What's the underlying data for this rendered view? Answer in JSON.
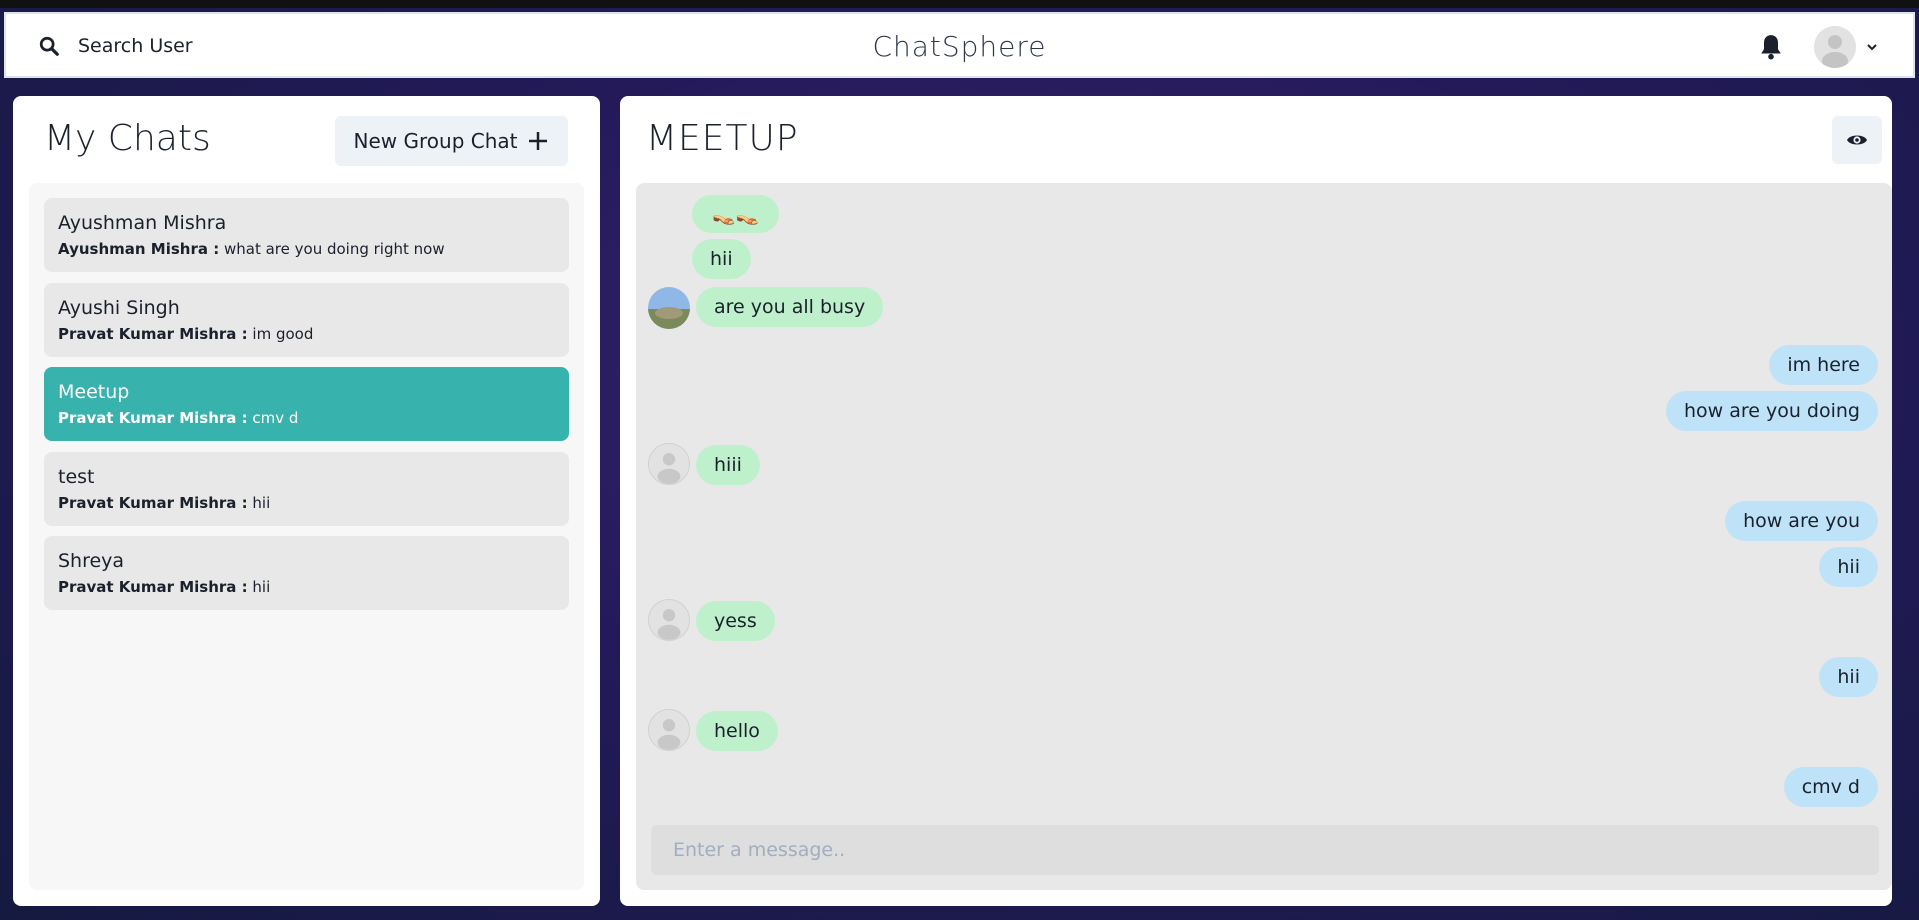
{
  "header": {
    "search_label": "Search User",
    "app_title": "ChatSphere",
    "icons": {
      "search": "search-icon",
      "notifications": "bell-icon",
      "profile": "avatar",
      "menu": "chevron-down-icon"
    }
  },
  "sidebar": {
    "title": "My Chats",
    "new_group_label": "New Group Chat",
    "chats": [
      {
        "name": "Ayushman Mishra",
        "sender": "Ayushman Mishra :",
        "message": "what are you doing right now",
        "active": false
      },
      {
        "name": "Ayushi Singh",
        "sender": "Pravat Kumar Mishra :",
        "message": "im good",
        "active": false
      },
      {
        "name": "Meetup",
        "sender": "Pravat Kumar Mishra :",
        "message": "cmv d",
        "active": true
      },
      {
        "name": "test",
        "sender": "Pravat Kumar Mishra :",
        "message": "hii",
        "active": false
      },
      {
        "name": "Shreya",
        "sender": "Pravat Kumar Mishra :",
        "message": "hii",
        "active": false
      }
    ]
  },
  "chat": {
    "title": "MEETUP",
    "messages": [
      {
        "from": "them",
        "text": "👡👡"
      },
      {
        "from": "them",
        "text": "hii"
      },
      {
        "from": "them",
        "text": "are you all busy"
      },
      {
        "from": "me",
        "text": "im here"
      },
      {
        "from": "me",
        "text": "how are you doing"
      },
      {
        "from": "them",
        "text": "hiii"
      },
      {
        "from": "me",
        "text": "how are you"
      },
      {
        "from": "me",
        "text": "hii"
      },
      {
        "from": "them",
        "text": "yess"
      },
      {
        "from": "me",
        "text": "hii"
      },
      {
        "from": "them",
        "text": "hello"
      },
      {
        "from": "me",
        "text": "cmv d"
      }
    ],
    "input_placeholder": "Enter a message.."
  },
  "colors": {
    "active_chat": "#38b2ac",
    "incoming_bubble": "#bef0cc",
    "outgoing_bubble": "#bee3f8",
    "background": "#241a5a"
  }
}
